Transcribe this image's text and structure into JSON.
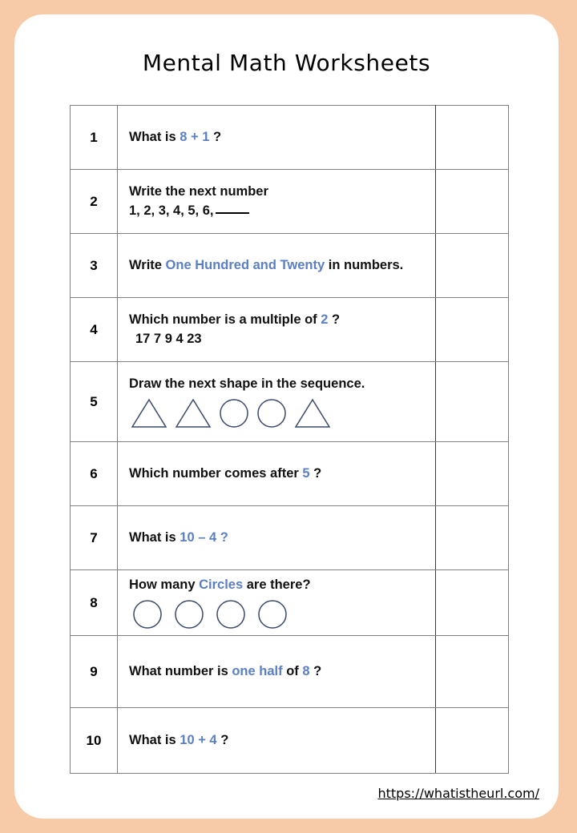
{
  "theme": {
    "background_color": "#f7cba8",
    "card_color": "#ffffff",
    "accent_blue": "#5b7fc4",
    "shape_outline": "#3a4a6b",
    "grid_color": "#808080"
  },
  "header": {
    "title": "Mental Math Worksheets"
  },
  "footer": {
    "url": "https://whatistheurl.com/"
  },
  "worksheet": {
    "answer_column_label": "",
    "questions": [
      {
        "number": "1",
        "lines": [
          [
            {
              "t": "What is ",
              "c": "black"
            },
            {
              "t": "8 + 1",
              "c": "blue"
            },
            {
              "t": " ?",
              "c": "black"
            }
          ]
        ],
        "shapes": []
      },
      {
        "number": "2",
        "lines": [
          [
            {
              "t": "Write the next number",
              "c": "black"
            }
          ],
          [
            {
              "t": "1, 2, 3, 4, 5, 6,",
              "c": "black"
            },
            {
              "t": "___",
              "c": "blank"
            }
          ]
        ],
        "shapes": []
      },
      {
        "number": "3",
        "lines": [
          [
            {
              "t": "Write ",
              "c": "black"
            },
            {
              "t": "One Hundred and Twenty",
              "c": "blue"
            },
            {
              "t": " in numbers.",
              "c": "black"
            }
          ]
        ],
        "shapes": []
      },
      {
        "number": "4",
        "lines": [
          [
            {
              "t": "Which number is a multiple of ",
              "c": "black"
            },
            {
              "t": "2",
              "c": "blue"
            },
            {
              "t": " ?",
              "c": "black"
            }
          ],
          [
            {
              "t": "17   7   9   4   23",
              "c": "black-indent"
            }
          ]
        ],
        "shapes": []
      },
      {
        "number": "5",
        "lines": [
          [
            {
              "t": "Draw the next shape in the sequence.",
              "c": "black"
            }
          ]
        ],
        "shapes": [
          "triangle",
          "triangle",
          "circle",
          "circle",
          "triangle"
        ]
      },
      {
        "number": "6",
        "lines": [
          [
            {
              "t": "Which number comes after ",
              "c": "black"
            },
            {
              "t": "5",
              "c": "blue"
            },
            {
              "t": " ?",
              "c": "black"
            }
          ]
        ],
        "shapes": []
      },
      {
        "number": "7",
        "lines": [
          [
            {
              "t": "What is ",
              "c": "black"
            },
            {
              "t": "10 – 4 ?",
              "c": "blue"
            }
          ]
        ],
        "shapes": []
      },
      {
        "number": "8",
        "lines": [
          [
            {
              "t": "How many ",
              "c": "black"
            },
            {
              "t": "Circles",
              "c": "blue"
            },
            {
              "t": " are there?",
              "c": "black"
            }
          ]
        ],
        "shapes": [
          "circle",
          "circle",
          "circle",
          "circle"
        ]
      },
      {
        "number": "9",
        "lines": [
          [
            {
              "t": "What number is ",
              "c": "black"
            },
            {
              "t": "one half",
              "c": "blue"
            },
            {
              "t": " of ",
              "c": "black"
            },
            {
              "t": "8",
              "c": "blue"
            },
            {
              "t": " ?",
              "c": "black"
            }
          ]
        ],
        "shapes": []
      },
      {
        "number": "10",
        "lines": [
          [
            {
              "t": "What is ",
              "c": "black"
            },
            {
              "t": "10 + 4",
              "c": "blue"
            },
            {
              "t": " ?",
              "c": "black"
            }
          ]
        ],
        "shapes": []
      }
    ]
  }
}
